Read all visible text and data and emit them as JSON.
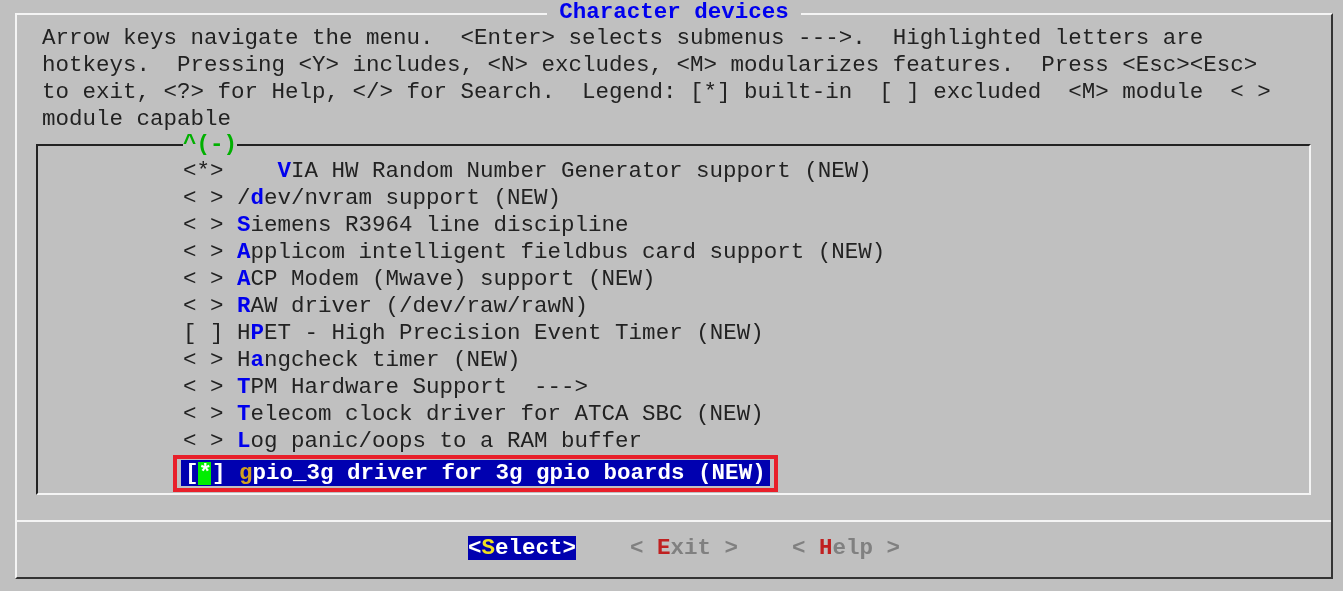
{
  "dialog": {
    "title": "Character devices",
    "help_lines": [
      "Arrow keys navigate the menu.  <Enter> selects submenus --->.  Highlighted letters are",
      "hotkeys.  Pressing <Y> includes, <N> excludes, <M> modularizes features.  Press <Esc><Esc>",
      "to exit, <?> for Help, </> for Search.  Legend: [*] built-in  [ ] excluded  <M> module  < >",
      "module capable"
    ],
    "scroll_indicator": "^(-)",
    "items": [
      {
        "prefix": "<*>",
        "indent": true,
        "hotkey": "V",
        "after": "IA HW Random Number Generator support (NEW)",
        "selected": false
      },
      {
        "prefix": "< >",
        "before": "/",
        "hotkey": "d",
        "after": "ev/nvram support (NEW)",
        "selected": false
      },
      {
        "prefix": "< >",
        "hotkey": "S",
        "after": "iemens R3964 line discipline",
        "selected": false
      },
      {
        "prefix": "< >",
        "hotkey": "A",
        "after": "pplicom intelligent fieldbus card support (NEW)",
        "selected": false
      },
      {
        "prefix": "< >",
        "hotkey": "A",
        "after": "CP Modem (Mwave) support (NEW)",
        "selected": false
      },
      {
        "prefix": "< >",
        "hotkey": "R",
        "after": "AW driver (/dev/raw/rawN)",
        "selected": false
      },
      {
        "prefix": "[ ]",
        "before": "H",
        "hotkey": "P",
        "after": "ET - High Precision Event Timer (NEW)",
        "selected": false
      },
      {
        "prefix": "< >",
        "before": "H",
        "hotkey": "a",
        "after": "ngcheck timer (NEW)",
        "selected": false
      },
      {
        "prefix": "< >",
        "hotkey": "T",
        "after": "PM Hardware Support  --->",
        "selected": false
      },
      {
        "prefix": "< >",
        "hotkey": "T",
        "after": "elecom clock driver for ATCA SBC (NEW)",
        "selected": false
      },
      {
        "prefix": "< >",
        "hotkey": "L",
        "after": "og panic/oops to a RAM buffer",
        "selected": false
      },
      {
        "prefix": "[*]",
        "hotkey": "g",
        "after": "pio_3g driver for 3g gpio boards (NEW)",
        "selected": true
      }
    ],
    "buttons": [
      {
        "before": "<",
        "hotkey": "S",
        "after": "elect>",
        "selected": true
      },
      {
        "before": "< ",
        "hotkey": "E",
        "after": "xit >",
        "selected": false
      },
      {
        "before": "< ",
        "hotkey": "H",
        "after": "elp >",
        "selected": false
      }
    ]
  }
}
